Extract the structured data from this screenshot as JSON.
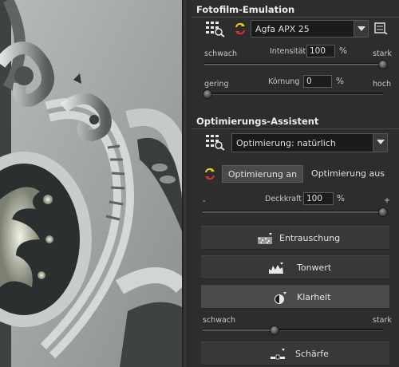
{
  "photo": {
    "description_icon": "baroque-ornament-photo"
  },
  "film_emulation": {
    "title": "Fotofilm-Emulation",
    "preset_selected": "Agfa APX 25",
    "intensity": {
      "label": "Intensität",
      "value": "100",
      "unit": "%",
      "min_label": "schwach",
      "max_label": "stark",
      "level": 1.0
    },
    "grain": {
      "label": "Körnung",
      "value": "0",
      "unit": "%",
      "min_label": "gering",
      "max_label": "hoch",
      "level": 0.0
    }
  },
  "optimization": {
    "title": "Optimierungs-Assistent",
    "preset_selected": "Optimierung: natürlich",
    "toggle_on_label": "Optimierung an",
    "toggle_off_label": "Optimierung aus",
    "opacity": {
      "label": "Deckkraft",
      "value": "100",
      "unit": "%",
      "min_label": "-",
      "max_label": "+",
      "level": 1.0
    },
    "tools": [
      {
        "label": "Entrauschung",
        "icon": "noise-reduction-icon",
        "active": false
      },
      {
        "label": "Tonwert",
        "icon": "histogram-icon",
        "active": false
      },
      {
        "label": "Klarheit",
        "icon": "clarity-icon",
        "active": true
      },
      {
        "label": "Schärfe",
        "icon": "sharpness-icon",
        "active": false
      }
    ],
    "clarity": {
      "min_label": "schwach",
      "max_label": "stark",
      "level": 0.4
    }
  },
  "colors": {
    "panel_bg": "#2d2d2d",
    "accent_yellow": "#f0d000",
    "accent_red": "#e03030"
  }
}
